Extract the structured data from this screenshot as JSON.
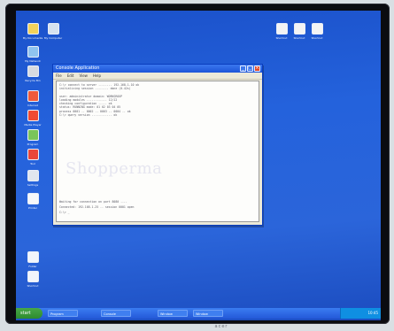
{
  "window": {
    "title": "Console Application",
    "menu": [
      "File",
      "Edit",
      "View",
      "Help"
    ],
    "buttons": {
      "minimize": "_",
      "maximize": "□",
      "close": "×"
    }
  },
  "console": {
    "lines": [
      "C:\\> connect to server ........ 192.168.1.10 ok",
      "    initializing session ........ done (0.42s)",
      "",
      "user: administrator  domain: WORKGROUP",
      "    loading modules ............ 12/12",
      "    checking configuration ..... ok",
      "    status: RUNNING   mode: 01 02 03 04 05",
      "    process 0001 .. 0002 .. 0003 .. 0004 .. ok",
      "C:\\> query version ............ ok"
    ],
    "watermark": "Shopperma",
    "lower_lines": [
      "Waiting for connection on port 8080 ....",
      "Connected: 192.168.1.25 -- session 0001 open",
      "C:\\> _"
    ]
  },
  "desktop_icons": [
    {
      "name": "my-documents-icon",
      "label": "My Documents",
      "color": "#f3d25a"
    },
    {
      "name": "my-computer-icon",
      "label": "My Computer",
      "color": "#d6e2ef"
    },
    {
      "name": "network-icon",
      "label": "My Network",
      "color": "#8fc3ef"
    },
    {
      "name": "recycle-bin-icon",
      "label": "Recycle Bin",
      "color": "#d7dbe0"
    },
    {
      "name": "browser-icon",
      "label": "Internet",
      "color": "#f05a3a"
    },
    {
      "name": "media-icon",
      "label": "Media Player",
      "color": "#f04a32"
    },
    {
      "name": "program-icon",
      "label": "Program",
      "color": "#7ac55a"
    },
    {
      "name": "tool-icon",
      "label": "Tool",
      "color": "#e9463a"
    },
    {
      "name": "settings-icon",
      "label": "Settings",
      "color": "#e0e6ee"
    },
    {
      "name": "printer-icon",
      "label": "Printer",
      "color": "#f5f7fa"
    },
    {
      "name": "folder-icon",
      "label": "Folder",
      "color": "#f2f5fb"
    },
    {
      "name": "shortcut-icon",
      "label": "Shortcut",
      "color": "#f2f5fb"
    }
  ],
  "top_icons": [
    {
      "name": "desktop-shortcut-a-icon",
      "label": "Shortcut",
      "color": "#f4f4f4"
    },
    {
      "name": "desktop-shortcut-b-icon",
      "label": "Shortcut",
      "color": "#f4f4f4"
    },
    {
      "name": "desktop-shortcut-c-icon",
      "label": "Shortcut",
      "color": "#f4f4f4"
    }
  ],
  "taskbar": {
    "start_label": "start",
    "tasks": [
      "Program",
      "Console",
      "Window",
      "Window"
    ],
    "clock": "10:45"
  },
  "monitor": {
    "brand": "acer"
  }
}
